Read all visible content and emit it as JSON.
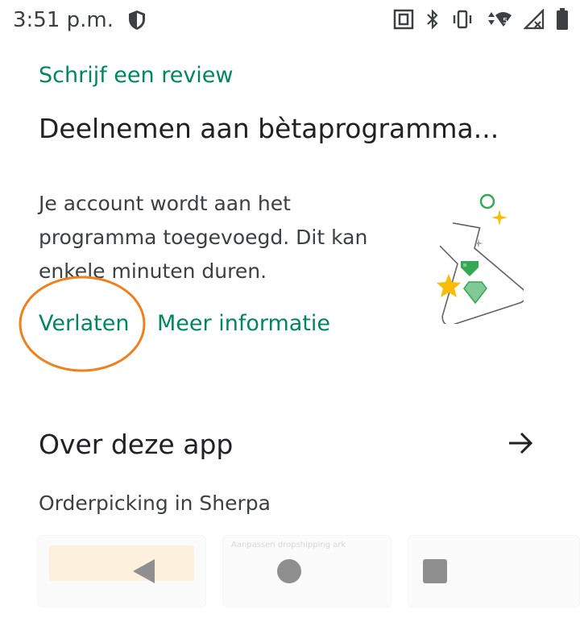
{
  "status_bar": {
    "time": "3:51 p.m.",
    "icons": [
      "shield-icon",
      "nfc-icon",
      "bluetooth-icon",
      "vibrate-icon",
      "wifi-icon",
      "no-signal-icon",
      "battery-icon"
    ],
    "wifi_badge": "5"
  },
  "beta": {
    "review_link": "Schrijf een review",
    "title": "Deelnemen aan bètaprogramma...",
    "description": "Je account wordt aan het programma toegevoegd. Dit kan enkele minuten duren.",
    "leave_label": "Verlaten",
    "more_info_label": "Meer informatie"
  },
  "about": {
    "title": "Over deze app",
    "description": "Orderpicking in Sherpa",
    "screenshot_text": "Aanpassen dropshipping ark"
  },
  "colors": {
    "accent": "#01875f",
    "highlight": "#f0801e",
    "text_primary": "#202124",
    "text_secondary": "#3c4043"
  }
}
